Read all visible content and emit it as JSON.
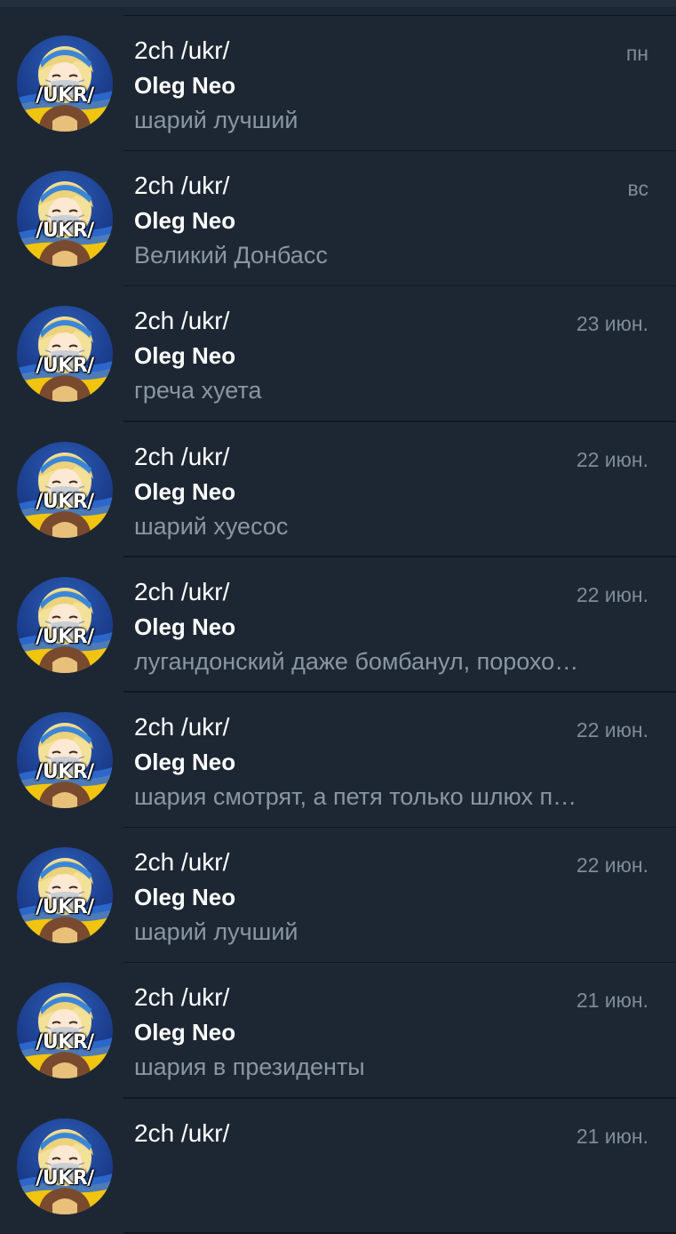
{
  "chats": [
    {
      "title": "2ch /ukr/",
      "date": "пн",
      "sender": "Oleg Neo",
      "preview": "шарий лучший",
      "avatar_tag": "/UKR/",
      "avatar_icon": "anime-girl-with-face-mask-avatar"
    },
    {
      "title": "2ch /ukr/",
      "date": "вс",
      "sender": "Oleg Neo",
      "preview": "Великий Донбасс",
      "avatar_tag": "/UKR/",
      "avatar_icon": "anime-girl-with-face-mask-avatar"
    },
    {
      "title": "2ch /ukr/",
      "date": "23 июн.",
      "sender": "Oleg Neo",
      "preview": "греча хуета",
      "avatar_tag": "/UKR/",
      "avatar_icon": "anime-girl-with-face-mask-avatar"
    },
    {
      "title": "2ch /ukr/",
      "date": "22 июн.",
      "sender": "Oleg Neo",
      "preview": "шарий хуесос",
      "avatar_tag": "/UKR/",
      "avatar_icon": "anime-girl-with-face-mask-avatar"
    },
    {
      "title": "2ch /ukr/",
      "date": "22 июн.",
      "sender": "Oleg Neo",
      "preview": "лугандонский даже бомбанул, порохо…",
      "avatar_tag": "/UKR/",
      "avatar_icon": "anime-girl-with-face-mask-avatar"
    },
    {
      "title": "2ch /ukr/",
      "date": "22 июн.",
      "sender": "Oleg Neo",
      "preview": "шария смотрят, а петя только шлюх п…",
      "avatar_tag": "/UKR/",
      "avatar_icon": "anime-girl-with-face-mask-avatar"
    },
    {
      "title": "2ch /ukr/",
      "date": "22 июн.",
      "sender": "Oleg Neo",
      "preview": "шарий лучший",
      "avatar_tag": "/UKR/",
      "avatar_icon": "anime-girl-with-face-mask-avatar"
    },
    {
      "title": "2ch /ukr/",
      "date": "21 июн.",
      "sender": "Oleg Neo",
      "preview": "шария в президенты",
      "avatar_tag": "/UKR/",
      "avatar_icon": "anime-girl-with-face-mask-avatar"
    },
    {
      "title": "2ch /ukr/",
      "date": "21 июн.",
      "sender": "",
      "preview": "",
      "avatar_tag": "/UKR/",
      "avatar_icon": "anime-girl-with-face-mask-avatar"
    }
  ],
  "colors": {
    "background": "#1d2733",
    "divider": "#101820",
    "title": "#ffffff",
    "date": "#7f8b98",
    "preview": "#8a96a3"
  }
}
